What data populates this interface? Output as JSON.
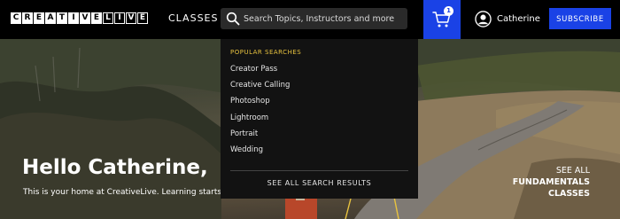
{
  "header": {
    "logo_letters": [
      "C",
      "R",
      "E",
      "A",
      "T",
      "I",
      "V",
      "E",
      "L",
      "I",
      "V",
      "E"
    ],
    "nav_classes": "CLASSES",
    "search": {
      "placeholder": "Search Topics, Instructors and more",
      "icon": "search-icon"
    },
    "cart": {
      "icon": "cart-icon",
      "badge": "1",
      "color": "#1a42e6"
    },
    "user": {
      "name": "Catherine",
      "icon": "user-avatar-icon"
    },
    "subscribe_label": "SUBSCRIBE"
  },
  "dropdown": {
    "heading": "POPULAR SEARCHES",
    "items": [
      "Creator Pass",
      "Creative Calling",
      "Photoshop",
      "Lightroom",
      "Portrait",
      "Wedding"
    ],
    "see_all": "SEE ALL SEARCH RESULTS",
    "heading_color": "#e8c33f"
  },
  "hero": {
    "title": "Hello Catherine,",
    "subtitle": "This is your home at CreativeLive. Learning starts here",
    "see_all": {
      "line1": "SEE ALL",
      "line2": "FUNDAMENTALS",
      "line3": "CLASSES"
    }
  }
}
